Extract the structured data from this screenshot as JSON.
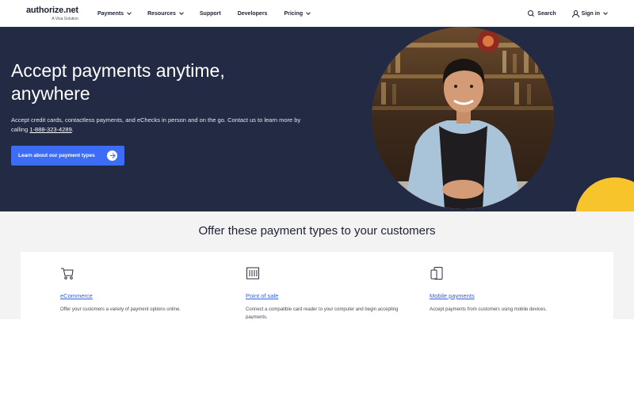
{
  "header": {
    "logo": "authorize.net",
    "logo_sub": "A Visa Solution",
    "nav": [
      {
        "label": "Payments",
        "dropdown": true
      },
      {
        "label": "Resources",
        "dropdown": true
      },
      {
        "label": "Support",
        "dropdown": false
      },
      {
        "label": "Developers",
        "dropdown": false
      },
      {
        "label": "Pricing",
        "dropdown": true
      }
    ],
    "search_label": "Search",
    "signin_label": "Sign in"
  },
  "hero": {
    "title": "Accept payments anytime, anywhere",
    "desc_prefix": "Accept credit cards, contactless payments, and eChecks in person and on the go. Contact us to learn more by calling ",
    "phone": "1-888-323-4289",
    "desc_suffix": ".",
    "cta_label": "Learn about our payment types"
  },
  "payment_types": {
    "title": "Offer these payment types to your customers",
    "items": [
      {
        "icon": "cart-icon",
        "label": "eCommerce",
        "desc": "Offer your customers a variety of payment options online."
      },
      {
        "icon": "card-reader-icon",
        "label": "Point of sale",
        "desc": "Connect a compatible card reader to your computer and begin accepting payments."
      },
      {
        "icon": "mobile-icon",
        "label": "Mobile payments",
        "desc": "Accept payments from customers using mobile devices."
      }
    ]
  },
  "colors": {
    "hero_bg": "#232a44",
    "cta": "#3d6cf5",
    "accent_yellow": "#f7c52b",
    "link": "#2f5fe3"
  }
}
